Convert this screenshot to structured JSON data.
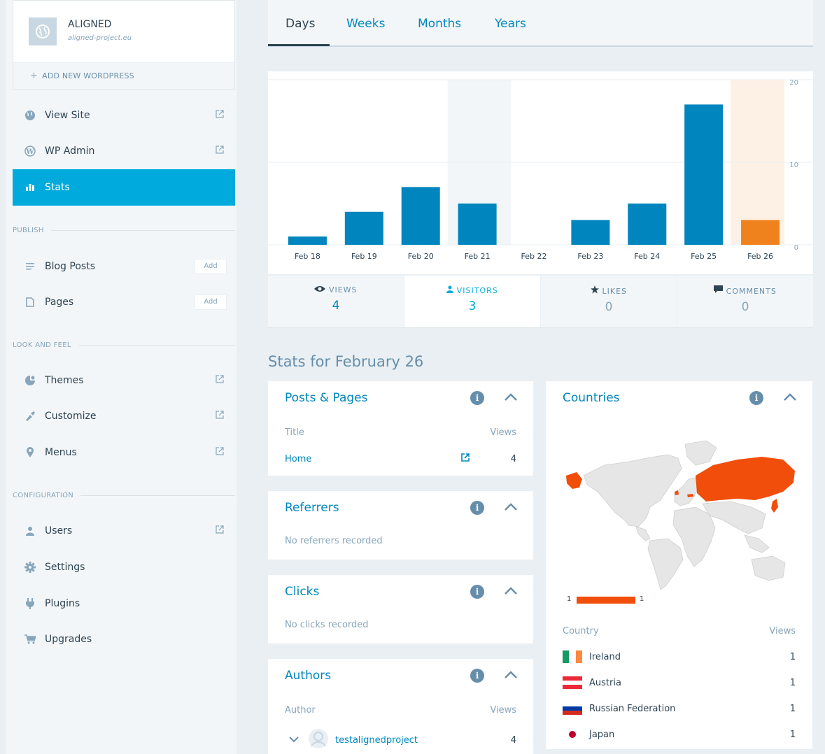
{
  "site": {
    "name": "ALIGNED",
    "url": "aligned-project.eu",
    "add_label": "ADD NEW WORDPRESS"
  },
  "sidebar": {
    "items": [
      {
        "label": "View Site"
      },
      {
        "label": "WP Admin"
      },
      {
        "label": "Stats"
      }
    ],
    "publish_header": "PUBLISH",
    "publish": [
      {
        "label": "Blog Posts",
        "add": "Add"
      },
      {
        "label": "Pages",
        "add": "Add"
      }
    ],
    "look_header": "LOOK AND FEEL",
    "look": [
      {
        "label": "Themes"
      },
      {
        "label": "Customize"
      },
      {
        "label": "Menus"
      }
    ],
    "config_header": "CONFIGURATION",
    "config": [
      {
        "label": "Users"
      },
      {
        "label": "Settings"
      },
      {
        "label": "Plugins"
      },
      {
        "label": "Upgrades"
      }
    ]
  },
  "tabs": [
    "Days",
    "Weeks",
    "Months",
    "Years"
  ],
  "chart_data": {
    "type": "bar",
    "categories": [
      "Feb 18",
      "Feb 19",
      "Feb 20",
      "Feb 21",
      "Feb 22",
      "Feb 23",
      "Feb 24",
      "Feb 25",
      "Feb 26"
    ],
    "values": [
      1,
      4,
      7,
      5,
      0,
      3,
      5,
      17,
      3
    ],
    "ylim": [
      0,
      20
    ],
    "yticks": [
      "20",
      "10",
      "0"
    ],
    "highlight_index": 8,
    "hover_index": 3,
    "bar_color": "#0085be",
    "highlight_color": "#f0821e"
  },
  "summary": [
    {
      "label": "VIEWS",
      "value": "4"
    },
    {
      "label": "VISITORS",
      "value": "3"
    },
    {
      "label": "LIKES",
      "value": "0"
    },
    {
      "label": "COMMENTS",
      "value": "0"
    }
  ],
  "stats_for": "Stats for February 26",
  "posts": {
    "title": "Posts & Pages",
    "col1": "Title",
    "col2": "Views",
    "row_label": "Home",
    "row_value": "4"
  },
  "referrers": {
    "title": "Referrers",
    "empty": "No referrers recorded"
  },
  "clicks": {
    "title": "Clicks",
    "empty": "No clicks recorded"
  },
  "authors": {
    "title": "Authors",
    "col1": "Author",
    "col2": "Views",
    "row_label": "testalignedproject",
    "row_value": "4"
  },
  "countries": {
    "title": "Countries",
    "legend_min": "1",
    "legend_max": "1",
    "col1": "Country",
    "col2": "Views",
    "rows": [
      {
        "name": "Ireland",
        "views": "1"
      },
      {
        "name": "Austria",
        "views": "1"
      },
      {
        "name": "Russian Federation",
        "views": "1"
      },
      {
        "name": "Japan",
        "views": "1"
      }
    ]
  },
  "icons": {
    "info": "i"
  }
}
